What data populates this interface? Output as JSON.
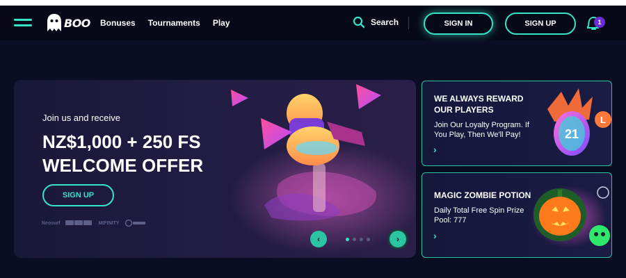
{
  "header": {
    "logo_text": "BOO",
    "nav": [
      "Bonuses",
      "Tournaments",
      "Play"
    ],
    "search_label": "Search",
    "signin_label": "SIGN IN",
    "signup_label": "SIGN UP",
    "notifications_count": "1"
  },
  "hero": {
    "subtitle": "Join us and receive",
    "title_line1": "NZ$1,000 + 250 FS",
    "title_line2": "WELCOME OFFER",
    "cta_label": "SIGN UP",
    "payments": [
      "Neosurf",
      "VISA",
      "MIFINITY"
    ],
    "carousel_prev": "‹",
    "carousel_next": "›",
    "active_slide": 1,
    "slide_count": 4
  },
  "promos": [
    {
      "title": "WE ALWAYS REWARD OUR PLAYERS",
      "text": "Join Our Loyalty Program. If You Play, Then We'll Pay!",
      "arrow": "›",
      "badge_number": "21"
    },
    {
      "title": "MAGIC ZOMBIE POTION",
      "text": "Daily Total Free Spin Prize Pool: 777",
      "arrow": "›"
    }
  ],
  "colors": {
    "accent": "#36e4c8",
    "background": "#0b0d24",
    "header": "#070918",
    "badge": "#6b2bd9"
  }
}
